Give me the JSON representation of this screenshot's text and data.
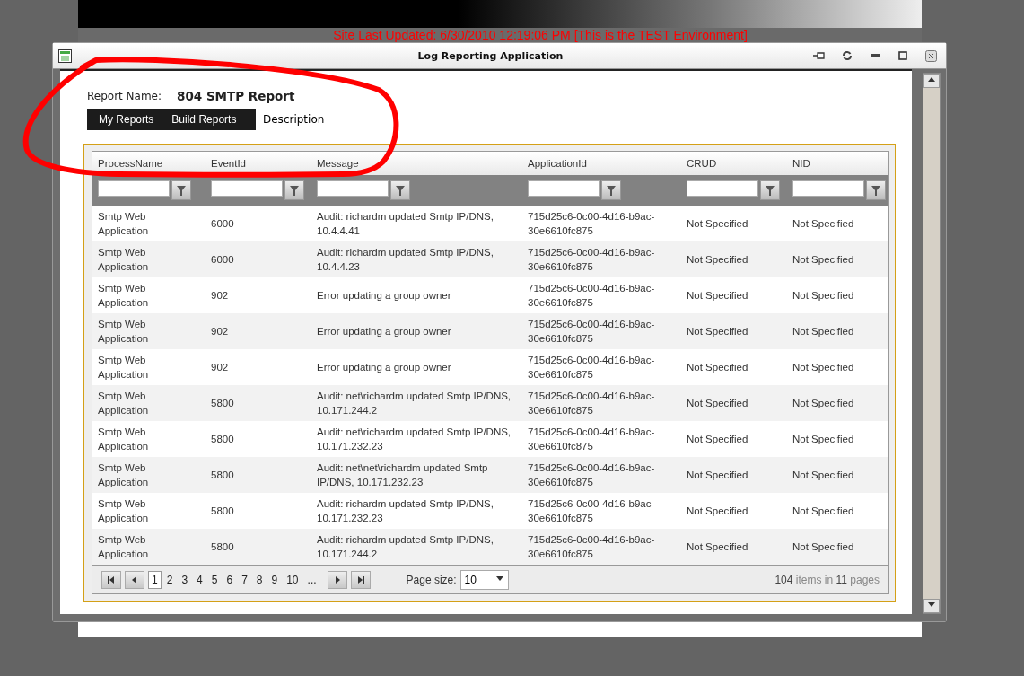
{
  "background_page": {
    "banner": "Site Last Updated: 6/30/2010 12:19:06 PM [This is the TEST Environment]"
  },
  "window": {
    "title": "Log Reporting Application"
  },
  "report": {
    "name_label": "Report Name:",
    "name": "804 SMTP Report",
    "description": "Description"
  },
  "menu": {
    "items": [
      {
        "label": "My Reports"
      },
      {
        "label": "Build Reports"
      }
    ]
  },
  "table": {
    "columns": [
      "ProcessName",
      "EventId",
      "Message",
      "ApplicationId",
      "CRUD",
      "NID"
    ],
    "rows": [
      [
        "Smtp Web Application",
        "6000",
        "Audit: richardm updated Smtp IP/DNS, 10.4.4.41",
        "715d25c6-0c00-4d16-b9ac-30e6610fc875",
        "Not Specified",
        "Not Specified"
      ],
      [
        "Smtp Web Application",
        "6000",
        "Audit: richardm updated Smtp IP/DNS, 10.4.4.23",
        "715d25c6-0c00-4d16-b9ac-30e6610fc875",
        "Not Specified",
        "Not Specified"
      ],
      [
        "Smtp Web Application",
        "902",
        "Error updating a group owner",
        "715d25c6-0c00-4d16-b9ac-30e6610fc875",
        "Not Specified",
        "Not Specified"
      ],
      [
        "Smtp Web Application",
        "902",
        "Error updating a group owner",
        "715d25c6-0c00-4d16-b9ac-30e6610fc875",
        "Not Specified",
        "Not Specified"
      ],
      [
        "Smtp Web Application",
        "902",
        "Error updating a group owner",
        "715d25c6-0c00-4d16-b9ac-30e6610fc875",
        "Not Specified",
        "Not Specified"
      ],
      [
        "Smtp Web Application",
        "5800",
        "Audit: net\\richardm updated Smtp IP/DNS, 10.171.244.2",
        "715d25c6-0c00-4d16-b9ac-30e6610fc875",
        "Not Specified",
        "Not Specified"
      ],
      [
        "Smtp Web Application",
        "5800",
        "Audit: net\\richardm updated Smtp IP/DNS, 10.171.232.23",
        "715d25c6-0c00-4d16-b9ac-30e6610fc875",
        "Not Specified",
        "Not Specified"
      ],
      [
        "Smtp Web Application",
        "5800",
        "Audit: net\\net\\richardm updated Smtp IP/DNS, 10.171.232.23",
        "715d25c6-0c00-4d16-b9ac-30e6610fc875",
        "Not Specified",
        "Not Specified"
      ],
      [
        "Smtp Web Application",
        "5800",
        "Audit: richardm updated Smtp IP/DNS, 10.171.232.23",
        "715d25c6-0c00-4d16-b9ac-30e6610fc875",
        "Not Specified",
        "Not Specified"
      ],
      [
        "Smtp Web Application",
        "5800",
        "Audit: richardm updated Smtp IP/DNS, 10.171.244.2",
        "715d25c6-0c00-4d16-b9ac-30e6610fc875",
        "Not Specified",
        "Not Specified"
      ]
    ]
  },
  "pager": {
    "pages": [
      {
        "label": "1",
        "selected": true
      },
      {
        "label": "2",
        "selected": false
      },
      {
        "label": "3",
        "selected": false
      },
      {
        "label": "4",
        "selected": false
      },
      {
        "label": "5",
        "selected": false
      },
      {
        "label": "6",
        "selected": false
      },
      {
        "label": "7",
        "selected": false
      },
      {
        "label": "8",
        "selected": false
      },
      {
        "label": "9",
        "selected": false
      },
      {
        "label": "10",
        "selected": false
      },
      {
        "label": "...",
        "selected": false
      }
    ],
    "page_size_label": "Page size:",
    "page_size": "10",
    "item_count": "104",
    "items_text": "items in",
    "page_count": "11",
    "pages_text": "pages"
  }
}
